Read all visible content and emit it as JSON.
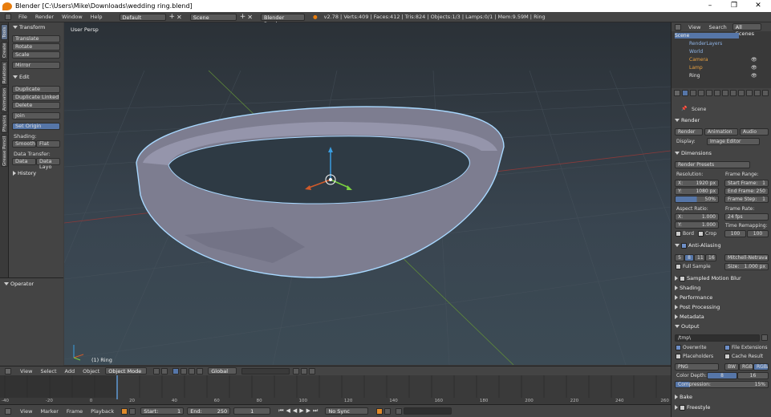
{
  "window": {
    "title": "Blender [C:\\Users\\Mike\\Downloads\\wedding ring.blend]",
    "minimize": "–",
    "maximize": "❐",
    "close": "✕"
  },
  "topbar": {
    "menus": [
      "File",
      "Render",
      "Window",
      "Help"
    ],
    "layout": "Default",
    "scene": "Scene",
    "engine": "Blender Render",
    "stats": "v2.78 | Verts:409 | Faces:412 | Tris:824 | Objects:1/3 | Lamps:0/1 | Mem:9.59M | Ring"
  },
  "left_tabs": [
    "Tools",
    "Create",
    "Relations",
    "Animation",
    "Physics",
    "Grease Pencil"
  ],
  "toolshelf": {
    "transform": {
      "title": "Transform",
      "buttons": [
        "Translate",
        "Rotate",
        "Scale",
        "Mirror"
      ]
    },
    "edit": {
      "title": "Edit",
      "buttons": [
        "Duplicate",
        "Duplicate Linked",
        "Delete",
        "Join"
      ],
      "set_origin": "Set Origin"
    },
    "shading": {
      "label": "Shading:",
      "smooth": "Smooth",
      "flat": "Flat"
    },
    "data_transfer": {
      "label": "Data Transfer:",
      "data": "Data",
      "data_layo": "Data Layo"
    },
    "history": "History"
  },
  "operator": {
    "title": "Operator"
  },
  "viewport": {
    "mode_label": "User Persp",
    "object_label": "(1) Ring",
    "colors": {
      "ring_fill": "#8a8a9c",
      "outline": "#a8d8ff"
    }
  },
  "viewport_header": {
    "menus": [
      "View",
      "Select",
      "Add",
      "Object"
    ],
    "mode": "Object Mode",
    "orientation": "Global"
  },
  "timeline": {
    "ticks": [
      "-40",
      "-20",
      "0",
      "20",
      "40",
      "60",
      "80",
      "100",
      "120",
      "140",
      "160",
      "180",
      "200",
      "220",
      "240",
      "260"
    ]
  },
  "timeline_header": {
    "menus": [
      "View",
      "Marker",
      "Frame",
      "Playback"
    ],
    "start": "Start:",
    "start_val": "1",
    "end": "End:",
    "end_val": "250",
    "current": "1",
    "sync": "No Sync"
  },
  "outliner": {
    "menus": [
      "View",
      "Search"
    ],
    "filter": "All Scenes",
    "items": [
      "Scene",
      "RenderLayers",
      "World",
      "Camera",
      "Lamp",
      "Ring"
    ]
  },
  "properties": {
    "context": "Scene",
    "render": {
      "title": "Render",
      "render_btn": "Render",
      "animation_btn": "Animation",
      "audio_btn": "Audio",
      "display_label": "Display:",
      "display": "Image Editor"
    },
    "dimensions": {
      "title": "Dimensions",
      "presets": "Render Presets",
      "resolution": "Resolution:",
      "res_x": "X:",
      "res_x_val": "1920 px",
      "res_y": "Y:",
      "res_y_val": "1080 px",
      "res_pct": "50%",
      "frame_range": "Frame Range:",
      "start_frame": "Start Frame:",
      "start_frame_val": "1",
      "end_frame": "End Frame:",
      "end_frame_val": "250",
      "frame_step": "Frame Step:",
      "frame_step_val": "1",
      "aspect": "Aspect Ratio:",
      "ax": "X:",
      "ax_val": "1.000",
      "ay": "Y:",
      "ay_val": "1.000",
      "frame_rate": "Frame Rate:",
      "fps": "24 fps",
      "time_remap": "Time Remapping:",
      "remap_old": "100",
      "remap_new": "100",
      "bord": "Bord",
      "crop": "Crop"
    },
    "anti_aliasing": {
      "title": "Anti-Aliasing",
      "samples": [
        "5",
        "8",
        "11",
        "16"
      ],
      "filter": "Mitchell-Netravali",
      "full_sample": "Full Sample",
      "size": "Size:",
      "size_val": "1.000 px"
    },
    "collapsed": [
      "Sampled Motion Blur",
      "Shading",
      "Performance",
      "Post Processing",
      "Metadata"
    ],
    "output": {
      "title": "Output",
      "path": "/tmp\\",
      "overwrite": "Overwrite",
      "file_ext": "File Extensions",
      "placeholders": "Placeholders",
      "cache": "Cache Result",
      "format": "PNG",
      "bw": "BW",
      "rgb": "RGB",
      "rgba": "RGBA",
      "depth_label": "Color Depth:",
      "depth8": "8",
      "depth16": "16",
      "compression": "Compression:",
      "compression_val": "15%"
    },
    "bake": "Bake",
    "freestyle": "Freestyle"
  }
}
